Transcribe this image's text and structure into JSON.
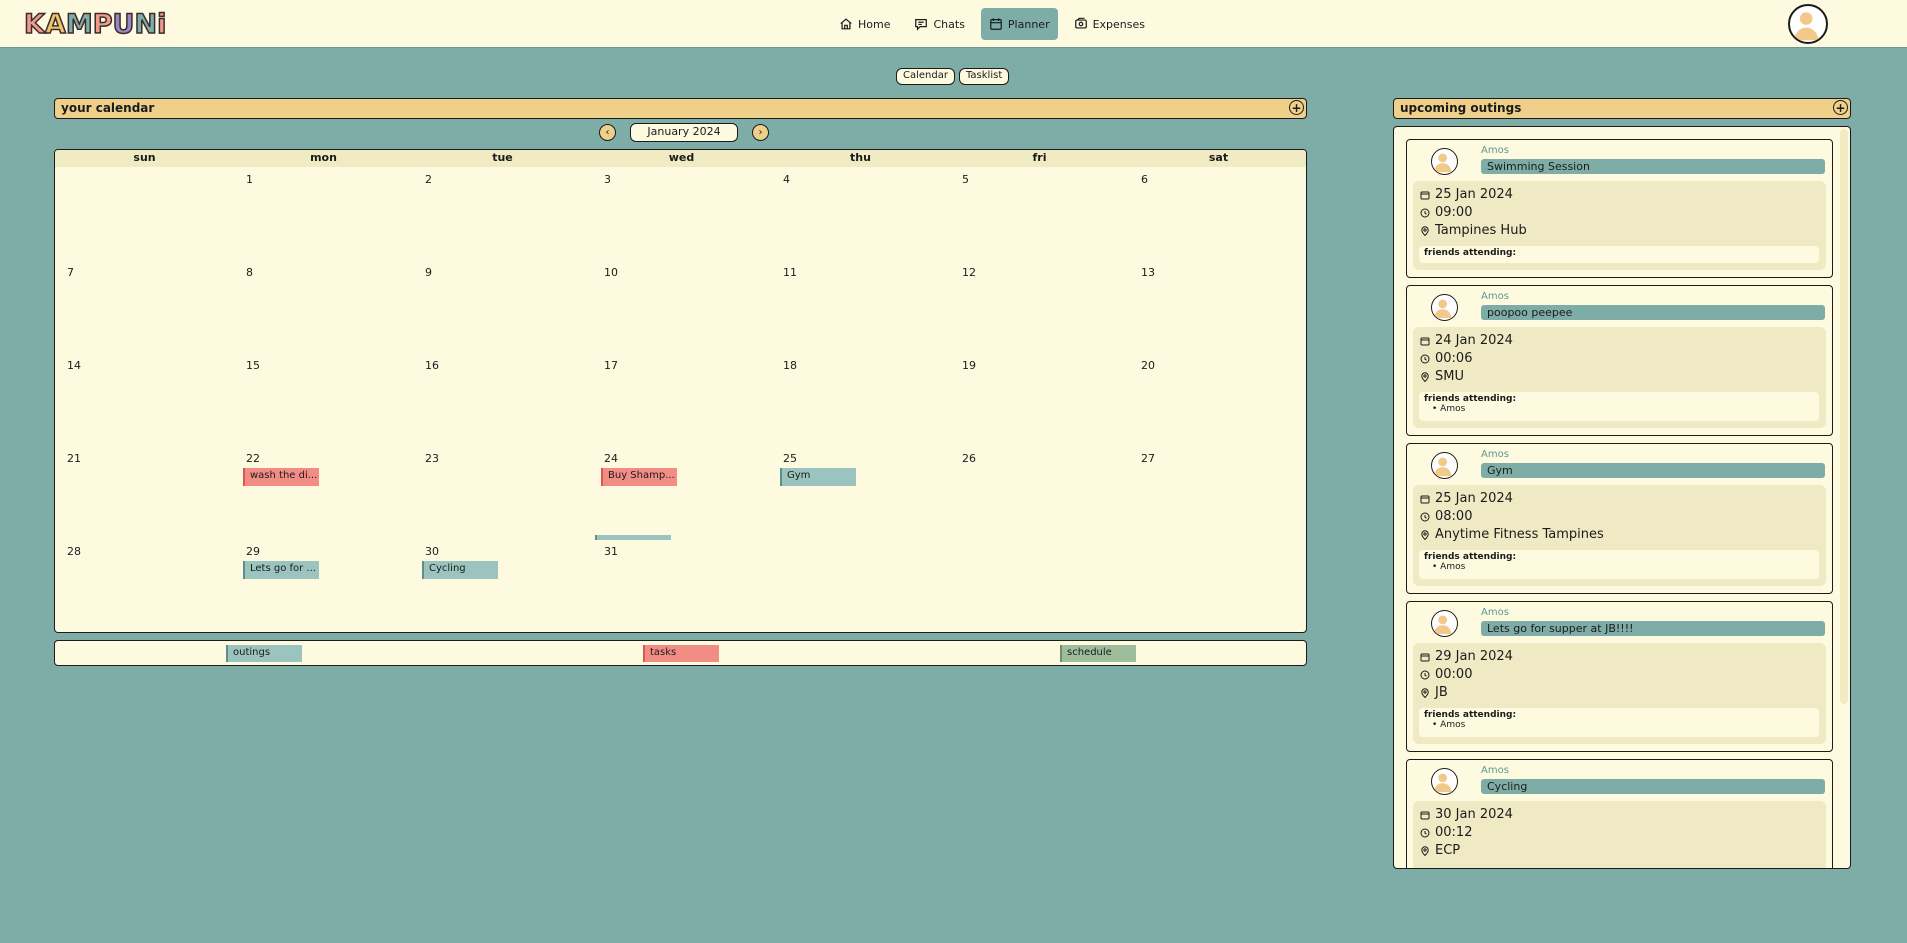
{
  "app": {
    "logo_text": "KAMPUNi"
  },
  "nav": {
    "items": [
      {
        "label": "Home",
        "icon": "home-icon"
      },
      {
        "label": "Chats",
        "icon": "chat-icon"
      },
      {
        "label": "Planner",
        "icon": "calendar-icon",
        "active": true
      },
      {
        "label": "Expenses",
        "icon": "wallet-icon"
      }
    ]
  },
  "view_toggle": {
    "calendar": "Calendar",
    "tasklist": "Tasklist"
  },
  "calendar": {
    "header_title": "your calendar",
    "month_label": "January 2024",
    "weekdays": [
      "sun",
      "mon",
      "tue",
      "wed",
      "thu",
      "fri",
      "sat"
    ],
    "days": [
      [
        "",
        "1",
        "2",
        "3",
        "4",
        "5",
        "6"
      ],
      [
        "7",
        "8",
        "9",
        "10",
        "11",
        "12",
        "13"
      ],
      [
        "14",
        "15",
        "16",
        "17",
        "18",
        "19",
        "20"
      ],
      [
        "21",
        "22",
        "23",
        "24",
        "25",
        "26",
        "27"
      ],
      [
        "28",
        "29",
        "30",
        "31",
        "",
        "",
        ""
      ]
    ],
    "events": {
      "wash": "wash the di...",
      "shampoo": "Buy Shamp...",
      "gym": "Gym",
      "supper": "Lets go for ...",
      "cycling": "Cycling"
    }
  },
  "legend": {
    "outings": "outings",
    "tasks": "tasks",
    "schedule": "schedule"
  },
  "colors": {
    "accent": "#7eada8",
    "header": "#eed08a",
    "task": "#f28d86",
    "outing": "#9cc4bf",
    "schedule": "#9dbd9b",
    "panel": "#fefae0"
  },
  "outings": {
    "header_title": "upcoming outings",
    "friends_label": "friends attending:",
    "cards": [
      {
        "user": "Amos",
        "title": "Swimming Session",
        "date": "25 Jan 2024",
        "time": "09:00",
        "place": "Tampines Hub",
        "friends": []
      },
      {
        "user": "Amos",
        "title": "poopoo peepee",
        "date": "24 Jan 2024",
        "time": "00:06",
        "place": "SMU",
        "friends": [
          "Amos"
        ]
      },
      {
        "user": "Amos",
        "title": "Gym",
        "date": "25 Jan 2024",
        "time": "08:00",
        "place": "Anytime Fitness Tampines",
        "friends": [
          "Amos"
        ]
      },
      {
        "user": "Amos",
        "title": "Lets go for supper at JB!!!!",
        "date": "29 Jan 2024",
        "time": "00:00",
        "place": "JB",
        "friends": [
          "Amos"
        ]
      },
      {
        "user": "Amos",
        "title": "Cycling",
        "date": "30 Jan 2024",
        "time": "00:12",
        "place": "ECP",
        "friends": []
      }
    ]
  }
}
